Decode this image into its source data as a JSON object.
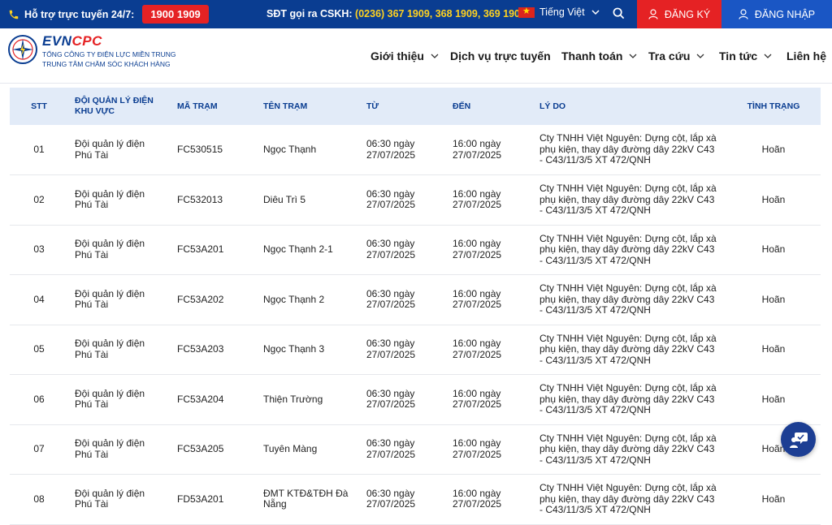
{
  "topbar": {
    "hotline_label": "Hỗ trợ trực tuyến 24/7:",
    "hotline_number": "1900 1909",
    "cskh_label": "SĐT gọi ra CSKH:",
    "cskh_numbers": "(0236) 367 1909, 368 1909, 369 1909",
    "language": "Tiếng Việt",
    "register_label": "ĐĂNG KÝ",
    "login_label": "ĐĂNG NHẬP",
    "accent_red": "#e52224",
    "accent_blue": "#0a3d91"
  },
  "logo": {
    "brand_evn": "EVN",
    "brand_cpc": "CPC",
    "sub1": "TỔNG CÔNG TY ĐIỆN LỰC MIỀN TRUNG",
    "sub2": "TRUNG TÂM CHĂM SÓC KHÁCH HÀNG"
  },
  "nav": {
    "items": [
      {
        "label": "Giới thiệu"
      },
      {
        "label": "Dịch vụ trực tuyến"
      },
      {
        "label": "Thanh toán"
      },
      {
        "label": "Tra cứu"
      },
      {
        "label": "Tin tức"
      },
      {
        "label": "Liên hệ"
      }
    ]
  },
  "table": {
    "headers": {
      "stt": "STT",
      "doi": "ĐỘI QUẢN LÝ ĐIỆN KHU VỰC",
      "ma_tram": "MÃ TRẠM",
      "ten_tram": "TÊN TRẠM",
      "tu": "TỪ",
      "den": "ĐẾN",
      "ly_do": "LÝ DO",
      "tinh_trang": "TÌNH TRẠNG"
    },
    "rows": [
      {
        "stt": "01",
        "doi": "Đội quản lý điện Phú Tài",
        "ma_tram": "FC530515",
        "ten_tram": "Ngọc Thạnh",
        "tu": "06:30 ngày 27/07/2025",
        "den": "16:00 ngày 27/07/2025",
        "ly_do": "Cty TNHH Việt Nguyên: Dựng cột, lắp xà phụ kiện, thay dây đường dây 22kV C43 - C43/11/3/5 XT 472/QNH",
        "tinh_trang": "Hoãn"
      },
      {
        "stt": "02",
        "doi": "Đội quản lý điện Phú Tài",
        "ma_tram": "FC532013",
        "ten_tram": "Diêu Trì 5",
        "tu": "06:30 ngày 27/07/2025",
        "den": "16:00 ngày 27/07/2025",
        "ly_do": "Cty TNHH Việt Nguyên: Dựng cột, lắp xà phụ kiện, thay dây đường dây 22kV C43 - C43/11/3/5 XT 472/QNH",
        "tinh_trang": "Hoãn"
      },
      {
        "stt": "03",
        "doi": "Đội quản lý điện Phú Tài",
        "ma_tram": "FC53A201",
        "ten_tram": "Ngọc Thạnh 2-1",
        "tu": "06:30 ngày 27/07/2025",
        "den": "16:00 ngày 27/07/2025",
        "ly_do": "Cty TNHH Việt Nguyên: Dựng cột, lắp xà phụ kiện, thay dây đường dây 22kV C43 - C43/11/3/5 XT 472/QNH",
        "tinh_trang": "Hoãn"
      },
      {
        "stt": "04",
        "doi": "Đội quản lý điện Phú Tài",
        "ma_tram": "FC53A202",
        "ten_tram": "Ngọc Thạnh 2",
        "tu": "06:30 ngày 27/07/2025",
        "den": "16:00 ngày 27/07/2025",
        "ly_do": "Cty TNHH Việt Nguyên: Dựng cột, lắp xà phụ kiện, thay dây đường dây 22kV C43 - C43/11/3/5 XT 472/QNH",
        "tinh_trang": "Hoãn"
      },
      {
        "stt": "05",
        "doi": "Đội quản lý điện Phú Tài",
        "ma_tram": "FC53A203",
        "ten_tram": "Ngọc Thạnh 3",
        "tu": "06:30 ngày 27/07/2025",
        "den": "16:00 ngày 27/07/2025",
        "ly_do": "Cty TNHH Việt Nguyên: Dựng cột, lắp xà phụ kiện, thay dây đường dây 22kV C43 - C43/11/3/5 XT 472/QNH",
        "tinh_trang": "Hoãn"
      },
      {
        "stt": "06",
        "doi": "Đội quản lý điện Phú Tài",
        "ma_tram": "FC53A204",
        "ten_tram": "Thiện Trường",
        "tu": "06:30 ngày 27/07/2025",
        "den": "16:00 ngày 27/07/2025",
        "ly_do": "Cty TNHH Việt Nguyên: Dựng cột, lắp xà phụ kiện, thay dây đường dây 22kV C43 - C43/11/3/5 XT 472/QNH",
        "tinh_trang": "Hoãn"
      },
      {
        "stt": "07",
        "doi": "Đội quản lý điện Phú Tài",
        "ma_tram": "FC53A205",
        "ten_tram": "Tuyên Màng",
        "tu": "06:30 ngày 27/07/2025",
        "den": "16:00 ngày 27/07/2025",
        "ly_do": "Cty TNHH Việt Nguyên: Dựng cột, lắp xà phụ kiện, thay dây đường dây 22kV C43 - C43/11/3/5 XT 472/QNH",
        "tinh_trang": "Hoãn"
      },
      {
        "stt": "08",
        "doi": "Đội quản lý điện Phú Tài",
        "ma_tram": "FD53A201",
        "ten_tram": "ĐMT KTĐ&TĐH Đà Nẵng",
        "tu": "06:30 ngày 27/07/2025",
        "den": "16:00 ngày 27/07/2025",
        "ly_do": "Cty TNHH Việt Nguyên: Dựng cột, lắp xà phụ kiện, thay dây đường dây 22kV C43 - C43/11/3/5 XT 472/QNH",
        "tinh_trang": "Hoãn"
      }
    ]
  },
  "icons": {
    "phone": "phone-icon",
    "search": "search-icon",
    "user": "user-icon",
    "chevron": "chevron-down-icon",
    "chat": "chat-support-icon"
  }
}
